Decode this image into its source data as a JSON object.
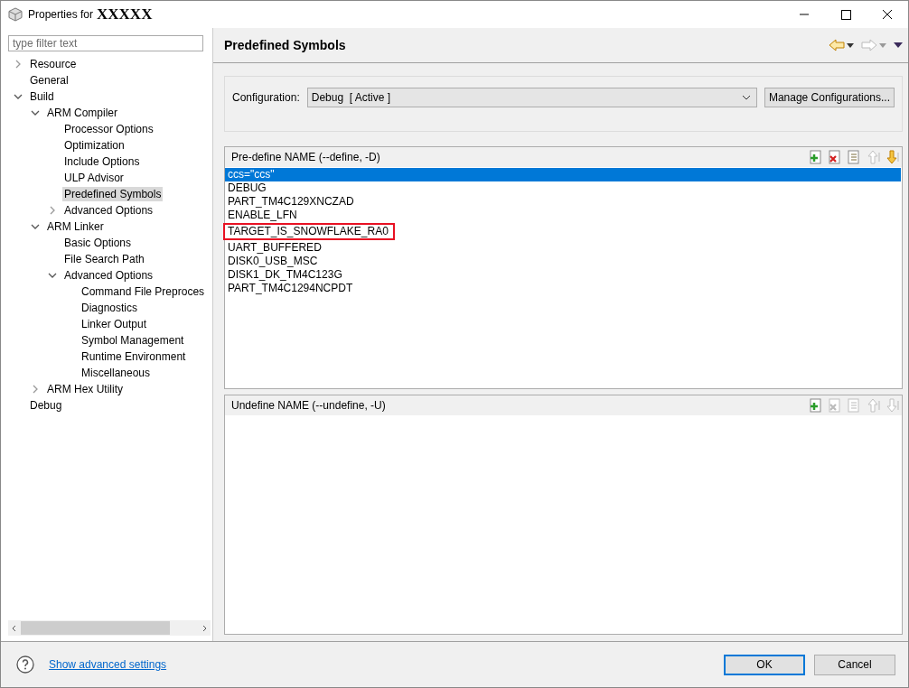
{
  "window": {
    "title": "Properties for",
    "title_redacted": "XXXXX"
  },
  "filter": {
    "placeholder": "type filter text"
  },
  "tree": [
    {
      "label": "Resource",
      "selected": false,
      "expanded": false
    },
    {
      "label": "General",
      "selected": false
    },
    {
      "label": "Build",
      "selected": false,
      "expanded": true,
      "children": [
        {
          "label": "ARM Compiler",
          "selected": false,
          "expanded": true,
          "children": [
            {
              "label": "Processor Options",
              "selected": false
            },
            {
              "label": "Optimization",
              "selected": false
            },
            {
              "label": "Include Options",
              "selected": false
            },
            {
              "label": "ULP Advisor",
              "selected": false
            },
            {
              "label": "Predefined Symbols",
              "selected": true
            },
            {
              "label": "Advanced Options",
              "selected": false,
              "expanded": false
            }
          ]
        },
        {
          "label": "ARM Linker",
          "selected": false,
          "expanded": true,
          "children": [
            {
              "label": "Basic Options",
              "selected": false
            },
            {
              "label": "File Search Path",
              "selected": false
            },
            {
              "label": "Advanced Options",
              "selected": false,
              "expanded": true,
              "children": [
                {
                  "label": "Command File Preproces",
                  "selected": false
                },
                {
                  "label": "Diagnostics",
                  "selected": false
                },
                {
                  "label": "Linker Output",
                  "selected": false
                },
                {
                  "label": "Symbol Management",
                  "selected": false
                },
                {
                  "label": "Runtime Environment",
                  "selected": false
                },
                {
                  "label": "Miscellaneous",
                  "selected": false
                }
              ]
            }
          ]
        },
        {
          "label": "ARM Hex Utility",
          "selected": false,
          "expanded": false
        }
      ]
    },
    {
      "label": "Debug",
      "selected": false
    }
  ],
  "page": {
    "title": "Predefined Symbols"
  },
  "configuration": {
    "label": "Configuration:",
    "value": "Debug  [ Active ]",
    "button": "Manage Configurations..."
  },
  "define_list": {
    "title": "Pre-define NAME (--define, -D)",
    "tools": [
      {
        "kind": "add",
        "disabled": false
      },
      {
        "kind": "delete",
        "disabled": false
      },
      {
        "kind": "edit",
        "disabled": false
      },
      {
        "kind": "up",
        "disabled": true
      },
      {
        "kind": "down",
        "disabled": false
      }
    ],
    "items": [
      {
        "text": "ccs=\"ccs\"",
        "selected": true,
        "annotated": false
      },
      {
        "text": "DEBUG",
        "selected": false,
        "annotated": false
      },
      {
        "text": "PART_TM4C129XNCZAD",
        "selected": false,
        "annotated": false
      },
      {
        "text": "ENABLE_LFN",
        "selected": false,
        "annotated": false
      },
      {
        "text": "TARGET_IS_SNOWFLAKE_RA0",
        "selected": false,
        "annotated": true
      },
      {
        "text": "UART_BUFFERED",
        "selected": false,
        "annotated": false
      },
      {
        "text": "DISK0_USB_MSC",
        "selected": false,
        "annotated": false
      },
      {
        "text": "DISK1_DK_TM4C123G",
        "selected": false,
        "annotated": false
      },
      {
        "text": "PART_TM4C1294NCPDT",
        "selected": false,
        "annotated": false
      }
    ]
  },
  "undefine_list": {
    "title": "Undefine NAME (--undefine, -U)",
    "tools": [
      {
        "kind": "add",
        "disabled": false
      },
      {
        "kind": "delete",
        "disabled": true
      },
      {
        "kind": "edit",
        "disabled": true
      },
      {
        "kind": "up",
        "disabled": true
      },
      {
        "kind": "down",
        "disabled": true
      }
    ]
  },
  "footer": {
    "link": "Show advanced settings",
    "buttons": [
      {
        "label": "OK",
        "default": true
      },
      {
        "label": "Cancel",
        "default": false
      }
    ]
  }
}
